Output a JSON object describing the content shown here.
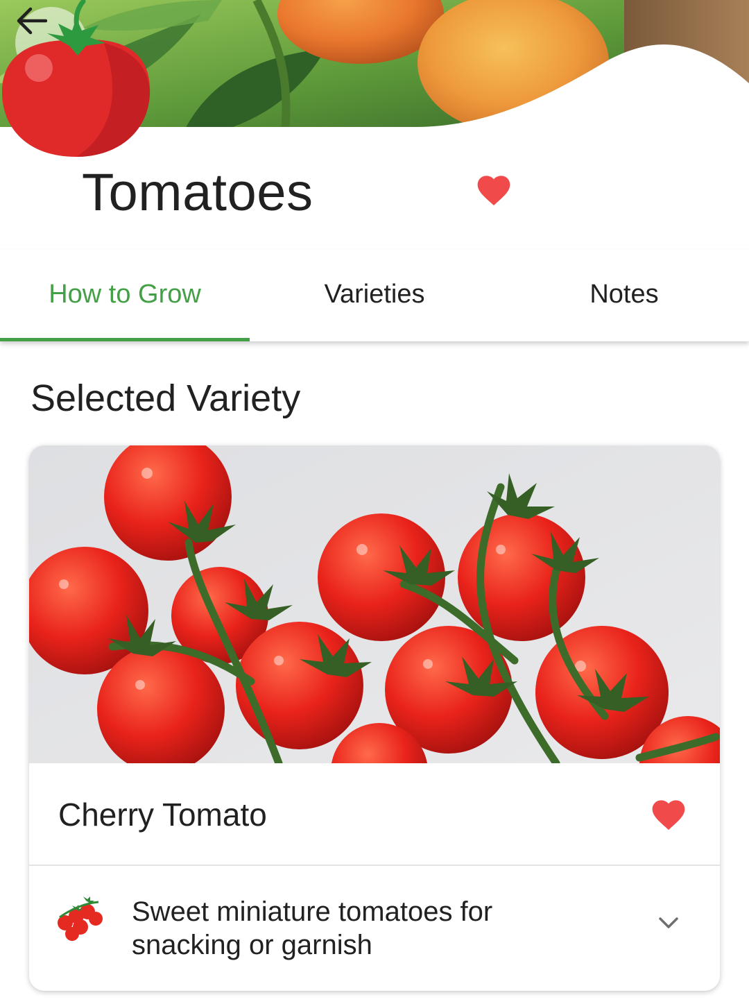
{
  "header": {
    "title": "Tomatoes",
    "back_icon": "arrow-left-icon",
    "favorite_icon": "heart-icon",
    "favorite_color": "#f04a4a",
    "illustration": "tomato-illustration"
  },
  "tabs": [
    {
      "label": "How to Grow",
      "active": true
    },
    {
      "label": "Varieties",
      "active": false
    },
    {
      "label": "Notes",
      "active": false
    }
  ],
  "accent_color": "#43a047",
  "content": {
    "section_title": "Selected Variety",
    "variety": {
      "name": "Cherry Tomato",
      "description": "Sweet miniature tomatoes for snacking or garnish",
      "favorite_icon": "heart-icon",
      "variety_icon": "cherry-tomatoes-icon",
      "expand_icon": "chevron-down-icon"
    }
  }
}
